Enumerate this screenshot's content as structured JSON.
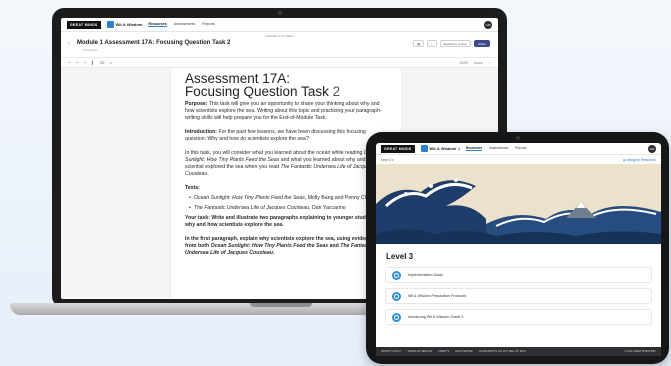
{
  "laptop": {
    "brand_logo": "GREAT MINDS",
    "product": "Wit & Wisdom",
    "nav": [
      "Resources",
      "Assessments",
      "Reports"
    ],
    "avatar_initials": "GM",
    "pager": "‹ Previous   1 of 1   Next ›",
    "doc_title": "Module 1 Assessment 17A: Focusing Question Task 2",
    "doc_subtitle": "Worksheet",
    "tool_labels": [
      "Expand to screen"
    ],
    "share_label": "Share",
    "toolbar_right": [
      "100%",
      "Zoom"
    ],
    "page": {
      "heading_line1": "Assessment 17A:",
      "heading_line2_text": "Focusing Question Task",
      "heading_line2_num": "2",
      "purpose_label": "Purpose:",
      "purpose_text": "This task will give you an opportunity to share your thinking about why and how scientists explore the sea. Writing about this topic and practicing your paragraph-writing skills will help prepare you for the End-of-Module Task.",
      "intro_label": "Introduction:",
      "intro_text": "For the past few lessons, we have been discussing this focusing question: Why and how do scientists explore the sea?",
      "task_text_a": "In this task, you will consider what you learned about the ocean while reading ",
      "task_title_1": "Ocean Sunlight: How Tiny Plants Feed the Seas",
      "task_text_b": " and what you learned about why and how one scientist explored the sea when you read ",
      "task_title_2": "The Fantastic Undersea Life of Jacques Cousteau",
      "task_text_c": ".",
      "texts_label": "Texts:",
      "text1_title": "Ocean Sunlight: How Tiny Plants Feed the Seas",
      "text1_author": ", Molly Bang and Penny Chisholm",
      "text2_title": "The Fantastic Undersea Life of Jacques Cousteau",
      "text2_author": ", Dan Yaccarino",
      "your_task": "Your task: Write and illustrate two paragraphs explaining to younger students why and how scientists explore the sea.",
      "first_para_a": "In the first paragraph, explain why scientists explore the sea, using evidence from both ",
      "first_para_t1": "Ocean Sunlight: How Tiny Plants Feed the Seas",
      "first_para_b": " and ",
      "first_para_t2": "The Fantastic Undersea Life of Jacques Cousteau",
      "first_para_c": "."
    }
  },
  "tablet": {
    "brand_logo": "GREAT MINDS",
    "product": "Wit & Wisdom",
    "nav": [
      "Resources",
      "Assessments",
      "Reports"
    ],
    "avatar_initials": "GM",
    "level_select": "Level 3",
    "assigned_link": "Assigned Resources",
    "level_heading": "Level 3",
    "resources": [
      "Implementation Guide",
      "Wit & Wisdom Preparation Protocols",
      "Introducing Wit & Wisdom Grade 3"
    ],
    "footer_links": [
      "PRIVACY POLICY",
      "TERMS OF SERVICE",
      "CREDITS",
      "HELP CENTER",
      "CA RESIDENTS: DO NOT SELL MY INFO"
    ],
    "footer_copy": "© 2024 GREAT MINDS PBC"
  },
  "colors": {
    "accent": "#2d7fd1",
    "share_button": "#3b4b8a",
    "footer_bg": "#2d2f33"
  }
}
